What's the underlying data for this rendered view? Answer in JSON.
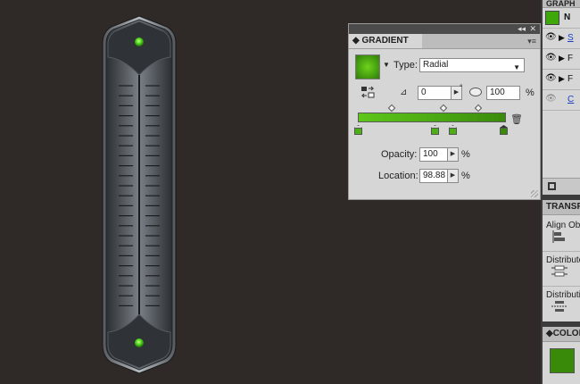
{
  "gradient_panel": {
    "tab_label": "GRADIENT",
    "collapse_glyph": "◂◂",
    "close_glyph": "✕",
    "menu_glyph": "▾≡",
    "type_label": "Type:",
    "type_value": "Radial",
    "angle_value": "0",
    "degree_symbol": "°",
    "aspect_value": "100",
    "percent": "%",
    "opacity_label": "Opacity:",
    "opacity_value": "100",
    "location_label": "Location:",
    "location_value": "98.88",
    "swatch_colors": [
      "#72d11c",
      "#327a0a"
    ],
    "stop_count": 4,
    "midpoint_count": 3
  },
  "graphic_styles_panel": {
    "header": "GRAPH",
    "rows": [
      {
        "letter": "N",
        "has_eye": false,
        "selected_swatch": true
      },
      {
        "letter": "S",
        "has_eye": true,
        "link": true
      },
      {
        "letter": "F",
        "has_eye": true
      },
      {
        "letter": "F",
        "has_eye": true
      },
      {
        "letter": "C",
        "has_eye": true,
        "link": true
      }
    ]
  },
  "transform_panel": {
    "header": "TRANSF",
    "align_label": "Align Ob",
    "distribute_1": "Distribute",
    "distribute_2": "Distributi"
  },
  "color_panel": {
    "header": "COLOR",
    "fill_color": "#3a8a0a"
  },
  "artwork": {
    "led_color": "#4fd61a",
    "body_color": "#3a3d41"
  }
}
